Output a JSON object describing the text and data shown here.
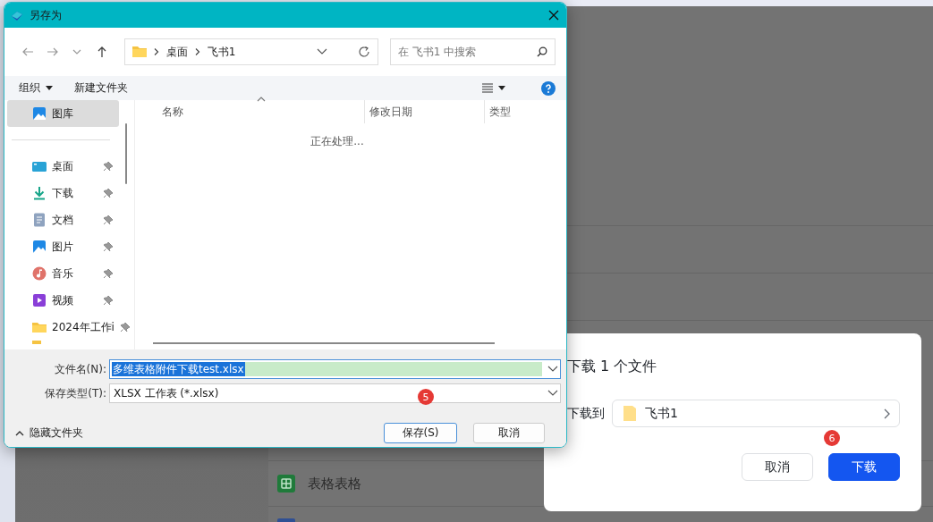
{
  "background": {
    "rows": [
      {
        "kind": "sheet",
        "label": "表格表格"
      },
      {
        "kind": "doc"
      }
    ]
  },
  "save_dialog": {
    "title": "另存为",
    "path": [
      "桌面",
      "飞书1"
    ],
    "search": {
      "placeholder": "在 飞书1 中搜索"
    },
    "toolbar": [
      "组织",
      "新建文件夹"
    ],
    "sidebar": [
      {
        "kind": "gallery",
        "label": "图库",
        "selected": true,
        "pinned": false
      },
      {
        "kind": "desktop",
        "label": "桌面",
        "selected": false,
        "pinned": true
      },
      {
        "kind": "download",
        "label": "下载",
        "selected": false,
        "pinned": true
      },
      {
        "kind": "docs",
        "label": "文档",
        "selected": false,
        "pinned": true
      },
      {
        "kind": "pictures",
        "label": "图片",
        "selected": false,
        "pinned": true
      },
      {
        "kind": "music",
        "label": "音乐",
        "selected": false,
        "pinned": true
      },
      {
        "kind": "video",
        "label": "视频",
        "selected": false,
        "pinned": true
      },
      {
        "kind": "folder",
        "label": "2024年工作i",
        "selected": false,
        "pinned": true
      }
    ],
    "columns": [
      "名称",
      "修改日期",
      "类型"
    ],
    "status": "正在处理...",
    "file_name": {
      "label": "文件名(N):",
      "value": "多维表格附件下载test.xlsx",
      "selected": true
    },
    "file_type": {
      "label": "保存类型(T):",
      "value": "XLSX 工作表 (*.xlsx)"
    },
    "hide_folders": "隐藏文件夹",
    "step_badge": "5",
    "buttons": [
      {
        "label": "保存(S)",
        "default": true
      },
      {
        "label": "取消",
        "default": false
      }
    ]
  },
  "download_dialog": {
    "title": "下载 1 个文件",
    "target_label": "下载到",
    "folder": "飞书1",
    "step_badge": "6",
    "buttons": [
      {
        "label": "取消",
        "primary": false
      },
      {
        "label": "下载",
        "primary": true
      }
    ]
  }
}
